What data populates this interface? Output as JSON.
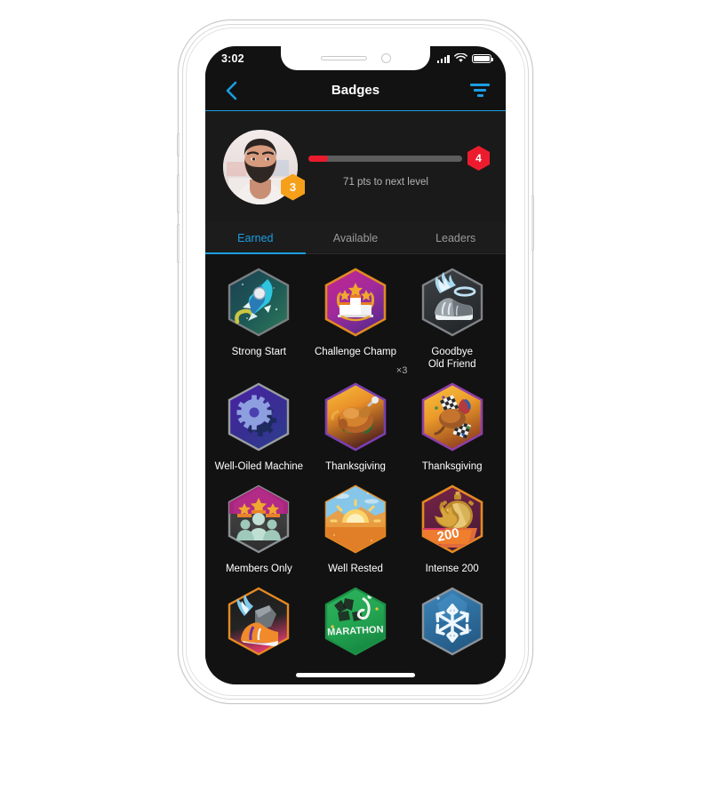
{
  "device": {
    "name": "smartphone-mockup",
    "notch_icons": [
      "speaker-slot",
      "front-camera"
    ]
  },
  "status_bar": {
    "time": "3:02",
    "icons": [
      "cellular-signal-icon",
      "wifi-icon",
      "battery-icon"
    ]
  },
  "header": {
    "back_icon": "chevron-left-icon",
    "title": "Badges",
    "filter_icon": "filter-icon",
    "accent_color": "#1b9ee0"
  },
  "profile": {
    "avatar_alt": "user-avatar-photo",
    "current_level": "3",
    "next_level": "4",
    "progress_percent": 13,
    "progress_label": "71 pts to next level",
    "level_badge_color": "#f6a01a",
    "next_badge_color": "#ec1c2e",
    "progress_fill_color": "#ea1b2d"
  },
  "tabs": [
    {
      "label": "Earned",
      "active": true
    },
    {
      "label": "Available",
      "active": false
    },
    {
      "label": "Leaders",
      "active": false
    }
  ],
  "badges": [
    {
      "label": "Strong Start",
      "icon": "rocket-badge-icon",
      "multiplier": ""
    },
    {
      "label": "Challenge Champ",
      "icon": "podium-trophy-badge-icon",
      "multiplier": "×3"
    },
    {
      "label": "Goodbye\nOld Friend",
      "icon": "winged-shoe-badge-icon",
      "multiplier": ""
    },
    {
      "label": "Well-Oiled Machine",
      "icon": "gears-badge-icon",
      "multiplier": ""
    },
    {
      "label": "Thanksgiving",
      "icon": "roast-turkey-badge-icon",
      "multiplier": ""
    },
    {
      "label": "Thanksgiving",
      "icon": "turkey-trot-badge-icon",
      "multiplier": ""
    },
    {
      "label": "Members Only",
      "icon": "group-people-badge-icon",
      "multiplier": ""
    },
    {
      "label": "Well Rested",
      "icon": "sunrise-badge-icon",
      "multiplier": ""
    },
    {
      "label": "Intense 200",
      "icon": "stopwatch-flame-200-badge-icon",
      "multiplier": ""
    },
    {
      "label": "",
      "icon": "winged-sneaker-badge-icon",
      "multiplier": ""
    },
    {
      "label": "",
      "icon": "marathon-graffiti-badge-icon",
      "multiplier": ""
    },
    {
      "label": "",
      "icon": "snowflake-badge-icon",
      "multiplier": ""
    }
  ]
}
